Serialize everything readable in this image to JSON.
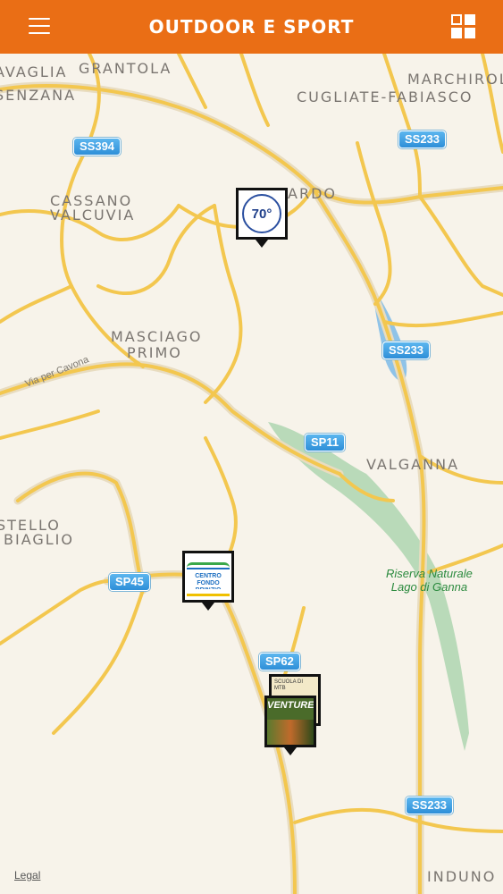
{
  "header": {
    "title": "OUTDOOR E SPORT",
    "menu_icon": "hamburger-menu-icon",
    "view_toggle_icon": "grid-view-icon"
  },
  "colors": {
    "header_bg": "#ea6e15",
    "map_bg": "#f7f3ea",
    "road": "#f3c74f",
    "park": "#8fc49a",
    "water": "#7fb9e0",
    "shield": "#2e8fd8"
  },
  "map": {
    "places": [
      "AVAGLIA",
      "GRANTOLA",
      "MARCHIROL",
      "SENZANA",
      "CUGLIATE-FABIASCO",
      "CASSANO",
      "VALCUVIA",
      "ARDO",
      "MASCIAGO",
      "PRIMO",
      "VALGANNA",
      "STELLO",
      "BIAGLIO",
      "INDUNO O"
    ],
    "road_shields": [
      "SS394",
      "SS233",
      "SS233",
      "SP11",
      "SP45",
      "SP62",
      "SS233"
    ],
    "route_label": "Via per Cavona",
    "reserve_label_1": "Riserva Naturale",
    "reserve_label_2": "Lago di Ganna",
    "markers": [
      {
        "label": "70°",
        "type": "anniversary-badge"
      },
      {
        "label": "CENTRO FONDO BRINZIO",
        "type": "logo"
      },
      {
        "label": "SCUOLA DI MTB",
        "type": "photo"
      },
      {
        "label": "VENTUREPA",
        "type": "photo"
      }
    ],
    "legal": "Legal"
  }
}
